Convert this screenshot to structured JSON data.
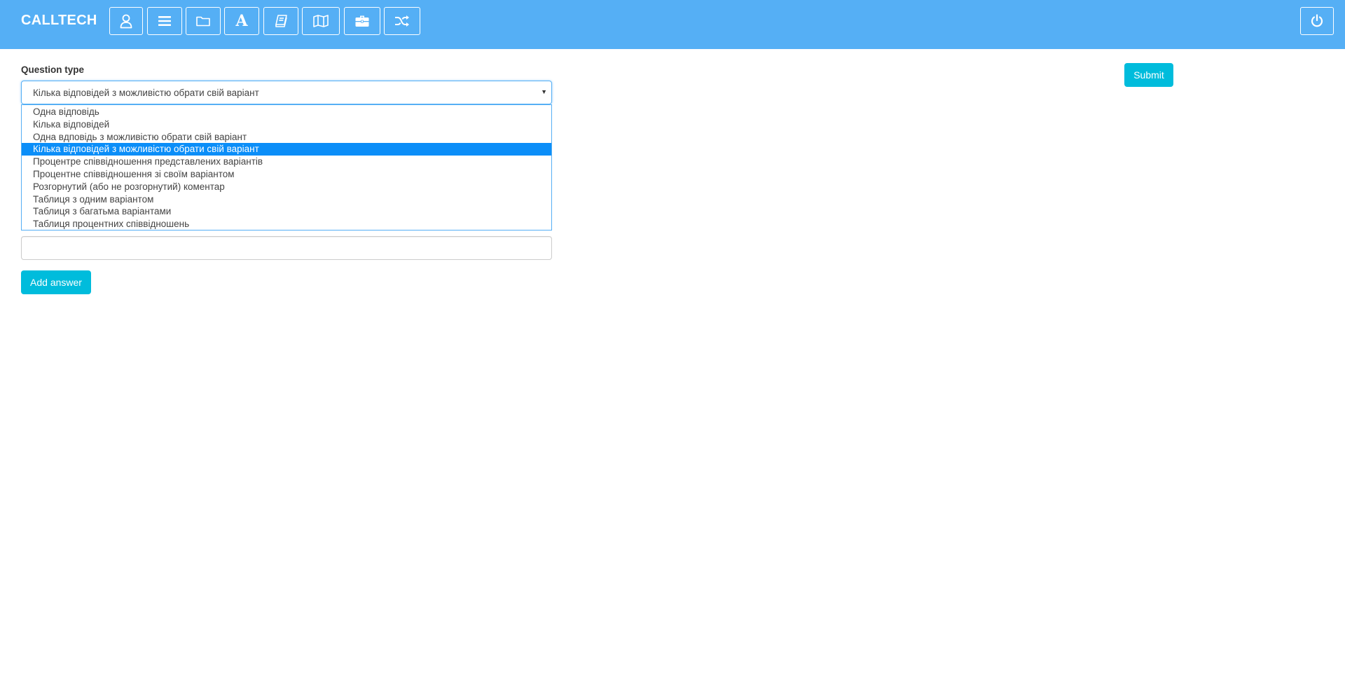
{
  "header": {
    "brand": "CALLTECH",
    "nav_icons": [
      "user-icon",
      "list-icon",
      "folder-icon",
      "font-icon",
      "book-icon",
      "map-icon",
      "briefcase-icon",
      "shuffle-icon"
    ],
    "power_icon": "power-icon",
    "letter_a": "A"
  },
  "form": {
    "question_type_label": "Question type",
    "question_type": {
      "selected": "Кілька відповідей з можливістю обрати свій варіант",
      "options": [
        "Одна відповідь",
        "Кілька відповідей",
        "Одна вдповідь з можливістю обрати свій варіант",
        "Кілька відповідей з можливістю обрати свій варіант",
        "Процентре співвідношення представлених варіантів",
        "Процентне співвідношення зі своїм варіантом",
        "Розгорнутий (або не розгорнутий) коментар",
        "Таблиця з одним варіантом",
        "Таблиця з багатьма варіантами",
        "Таблиця процентних співвідношень"
      ],
      "selected_index": 3
    },
    "answer_input_value": "",
    "add_answer_label": "Add answer",
    "submit_label": "Submit"
  },
  "colors": {
    "header_bg": "#55aff5",
    "accent_button": "#00bcdc",
    "selected_option": "#0b8ef8"
  }
}
